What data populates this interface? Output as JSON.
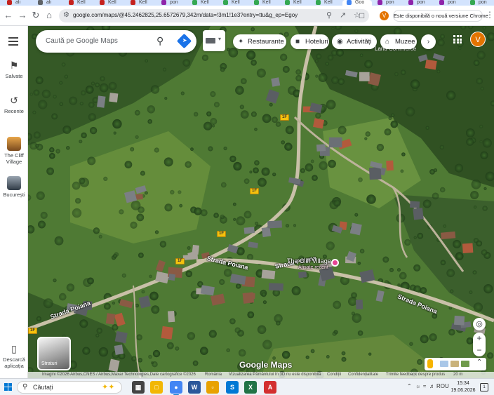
{
  "browser": {
    "tabs": [
      {
        "label": "ali",
        "fav_color": "#c5221f"
      },
      {
        "label": "ali",
        "fav_color": "#5f6368"
      },
      {
        "label": "Kell",
        "fav_color": "#c5221f"
      },
      {
        "label": "Kell",
        "fav_color": "#c5221f"
      },
      {
        "label": "Kell",
        "fav_color": "#c5221f"
      },
      {
        "label": "pon",
        "fav_color": "#8e24aa"
      },
      {
        "label": "Kell",
        "fav_color": "#34a853"
      },
      {
        "label": "Kell",
        "fav_color": "#34a853"
      },
      {
        "label": "Kell",
        "fav_color": "#34a853"
      },
      {
        "label": "Kell",
        "fav_color": "#34a853"
      },
      {
        "label": "Kell",
        "fav_color": "#34a853"
      },
      {
        "label": "Goo",
        "fav_color": "#4285f4",
        "active": true
      },
      {
        "label": "pon",
        "fav_color": "#8e24aa"
      },
      {
        "label": "pon",
        "fav_color": "#8e24aa"
      },
      {
        "label": "pon",
        "fav_color": "#8e24aa"
      },
      {
        "label": "pon",
        "fav_color": "#34a853"
      }
    ],
    "url": "google.com/maps/@45.2462825,25.6572679,342m/data=!3m1!1e3?entry=ttu&g_ep=EgoyMDI2...",
    "profile_initial": "V",
    "update_notice": "Este disponibilă o nouă versiune Chrome"
  },
  "rail": {
    "saved_label": "Salvate",
    "recent_label": "Recente",
    "recent_places": [
      {
        "label": "The Cliff Village"
      },
      {
        "label": "București"
      }
    ],
    "download_label": "Descarcă aplicația"
  },
  "maps": {
    "search_placeholder": "Caută pe Google Maps",
    "chips": [
      {
        "label": "Restaurante",
        "icon": "fork-knife-icon"
      },
      {
        "label": "Hoteluri",
        "icon": "bed-icon"
      },
      {
        "label": "Activități",
        "icon": "camera-icon"
      },
      {
        "label": "Muzee",
        "icon": "museum-icon"
      }
    ],
    "avatar_initial": "V",
    "layers_label": "Straturi",
    "google_logo": "Google Maps",
    "street_labels": [
      "Strada Poiana",
      "Strada Poiana",
      "Strada Poiana",
      "Strada Poiana"
    ],
    "road_badges": [
      "1F",
      "1F",
      "1F",
      "1F",
      "1F"
    ],
    "place_label": "The Cliff Village",
    "place_sublabel": "Afișate recent",
    "faint_label": "Land Commerce",
    "attribution": {
      "imagery": "Imagini ©2026 Airbus,CNES / Airbus,Maxar Technologies,Date cartografice ©2026",
      "country": "România",
      "view3d": "Vizualizarea Pământului în 3D nu este disponibilă",
      "terms": "Condiții",
      "privacy": "Confidențialitate",
      "feedback": "Trimite feedback despre produs",
      "scale": "20 m"
    }
  },
  "taskbar": {
    "search_placeholder": "Căutați",
    "language": "ROU",
    "time": "15:34",
    "date": "19.06.2026",
    "notification_count": "1"
  },
  "colors": {
    "accent": "#1a73e8",
    "avatar": "#e37400",
    "pin": "#e84393",
    "road_badge": "#f4c20d"
  }
}
